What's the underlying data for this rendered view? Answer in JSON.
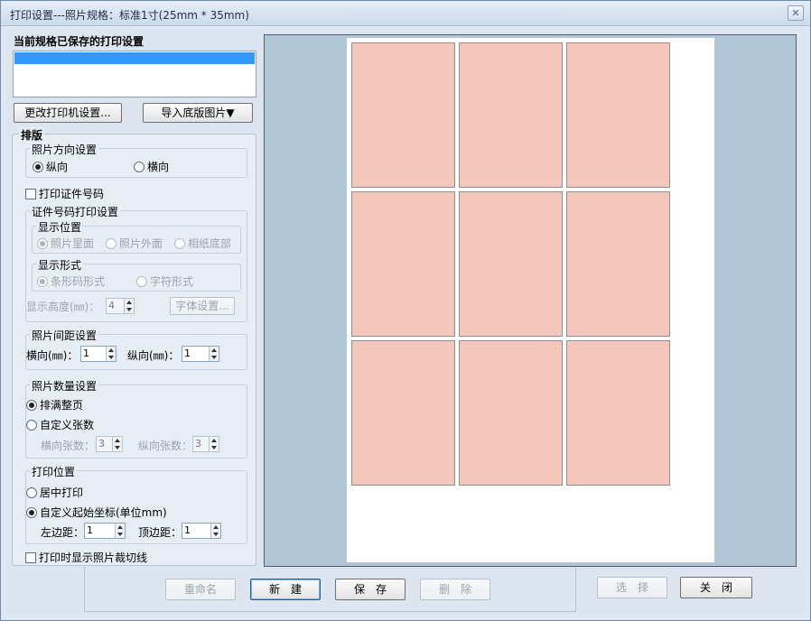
{
  "window": {
    "title": "打印设置---照片规格：标准1寸(25mm * 35mm)",
    "close_symbol": "✕"
  },
  "saved": {
    "label": "当前规格已保存的打印设置"
  },
  "buttons": {
    "change_printer": "更改打印机设置...",
    "import_template": "导入底版图片▼",
    "font_settings": "字体设置...",
    "rename": "重命名",
    "new": "新　建",
    "save": "保　存",
    "delete": "删　除",
    "select": "选　择",
    "close": "关　闭"
  },
  "layout": {
    "title": "排版",
    "orientation": {
      "title": "照片方向设置",
      "portrait": "纵向",
      "landscape": "横向",
      "selected": "portrait"
    },
    "print_id_label": "打印证件号码",
    "id_print": {
      "title": "证件号码打印设置",
      "position": {
        "title": "显示位置",
        "options": [
          "照片里面",
          "照片外面",
          "相纸底部"
        ]
      },
      "format": {
        "title": "显示形式",
        "options": [
          "条形码形式",
          "字符形式"
        ]
      },
      "height_label": "显示高度(㎜)：",
      "height_value": "4"
    },
    "spacing": {
      "title": "照片间距设置",
      "h_label": "横向(㎜)：",
      "h_value": "1",
      "v_label": "纵向(㎜)：",
      "v_value": "1"
    },
    "count": {
      "title": "照片数量设置",
      "fill_page": "排满整页",
      "custom": "自定义张数",
      "h_label": "横向张数：",
      "h_value": "3",
      "v_label": "纵向张数：",
      "v_value": "3"
    },
    "position": {
      "title": "打印位置",
      "center": "居中打印",
      "custom": "自定义起始坐标(单位mm)",
      "left_label": "左边距：",
      "left_value": "1",
      "top_label": "顶边距：",
      "top_value": "1"
    },
    "crop_lines_label": "打印时显示照片裁切线"
  },
  "preview": {
    "rows": 3,
    "cols": 3,
    "photo_color": "#f3c7bb"
  }
}
